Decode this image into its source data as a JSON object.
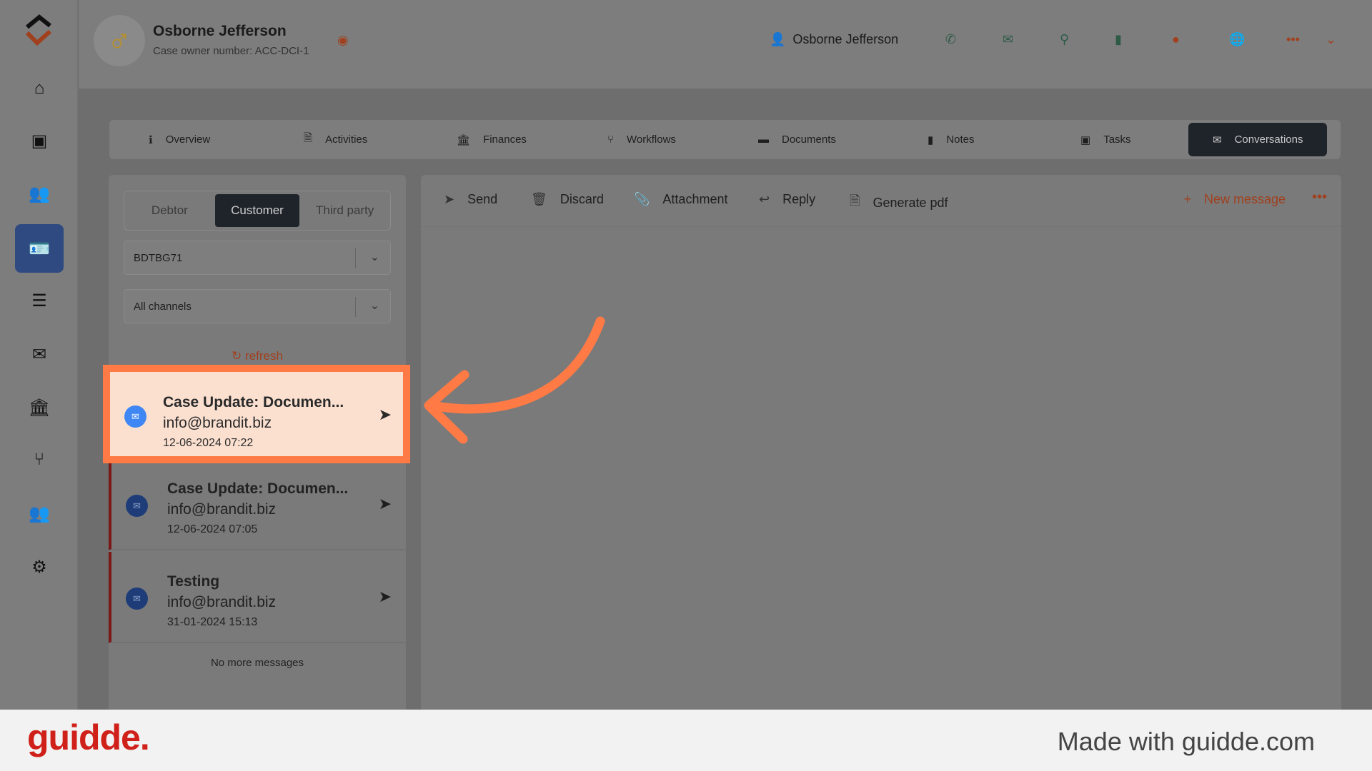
{
  "header": {
    "name": "Osborne Jefferson",
    "case_owner": "Case owner number: ACC-DCI-1",
    "contact_name": "Osborne Jefferson"
  },
  "sidebar": {
    "items": [
      "home-icon",
      "ticket-icon",
      "users-icon",
      "id-card-icon",
      "database-icon",
      "envelope-icon",
      "bank-icon",
      "branch-icon",
      "users-gear-icon",
      "gear-icon"
    ],
    "active": "id-card-icon"
  },
  "tabs": [
    {
      "label": "Overview"
    },
    {
      "label": "Activities"
    },
    {
      "label": "Finances"
    },
    {
      "label": "Workflows"
    },
    {
      "label": "Documents"
    },
    {
      "label": "Notes"
    },
    {
      "label": "Tasks"
    },
    {
      "label": "Conversations",
      "active": true
    }
  ],
  "left": {
    "segments": [
      "Debtor",
      "Customer",
      "Third party"
    ],
    "selected_segment": "Customer",
    "case_select": "BDTBG71",
    "channel_select": "All channels",
    "refresh": "refresh",
    "no_more": "No more messages",
    "messages": [
      {
        "title": "Case Update: Documen...",
        "email": "info@brandit.biz",
        "date": "12-06-2024 07:22"
      },
      {
        "title": "Case Update: Documen...",
        "email": "info@brandit.biz",
        "date": "12-06-2024 07:05"
      },
      {
        "title": "Testing",
        "email": "info@brandit.biz",
        "date": "31-01-2024 15:13"
      }
    ]
  },
  "toolbar": {
    "send": "Send",
    "discard": "Discard",
    "attachment": "Attachment",
    "reply": "Reply",
    "generate_pdf": "Generate pdf",
    "new_message": "New message"
  },
  "footer": {
    "logo": "guidde.",
    "made_with": "Made with guidde.com"
  },
  "colors": {
    "highlight": "#ff7a45",
    "accent": "#a0401e",
    "active_tab": "#1f242b"
  }
}
